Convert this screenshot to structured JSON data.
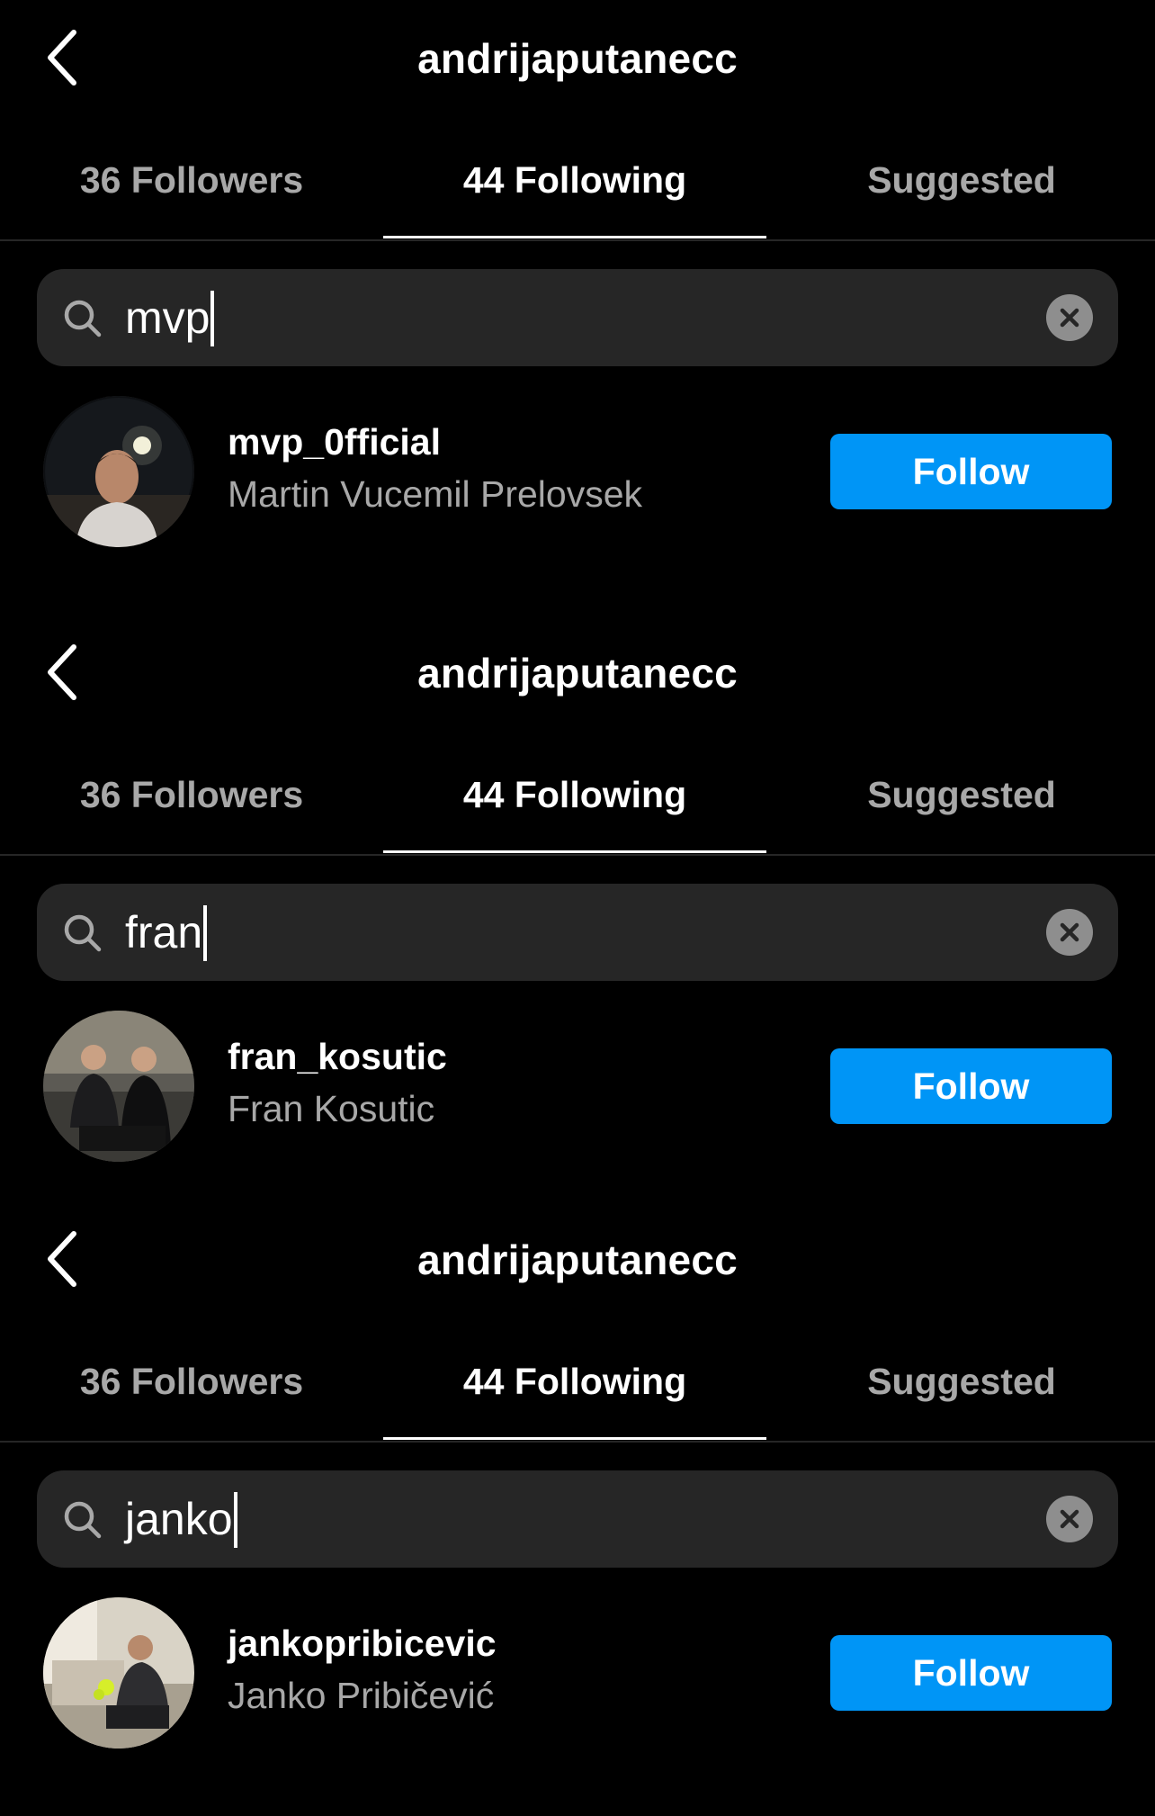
{
  "accent_color": "#0095f6",
  "panels": [
    {
      "header": {
        "back_icon": "chevron-left-icon",
        "title": "andrijaputanecc"
      },
      "tabs": [
        "36 Followers",
        "44 Following",
        "Suggested"
      ],
      "active_tab": "44 Following",
      "search": {
        "icon": "search-icon",
        "value": "mvp",
        "clear_icon": "clear-icon"
      },
      "result": {
        "username": "mvp_0fficial",
        "full_name": "Martin Vucemil Prelovsek",
        "button": "Follow"
      }
    },
    {
      "header": {
        "back_icon": "chevron-left-icon",
        "title": "andrijaputanecc"
      },
      "tabs": [
        "36 Followers",
        "44 Following",
        "Suggested"
      ],
      "active_tab": "44 Following",
      "search": {
        "icon": "search-icon",
        "value": "fran",
        "clear_icon": "clear-icon"
      },
      "result": {
        "username": "fran_kosutic",
        "full_name": "Fran Kosutic",
        "button": "Follow"
      }
    },
    {
      "header": {
        "back_icon": "chevron-left-icon",
        "title": "andrijaputanecc"
      },
      "tabs": [
        "36 Followers",
        "44 Following",
        "Suggested"
      ],
      "active_tab": "44 Following",
      "search": {
        "icon": "search-icon",
        "value": "janko",
        "clear_icon": "clear-icon"
      },
      "result": {
        "username": "jankopribicevic",
        "full_name": "Janko Pribičević",
        "button": "Follow"
      }
    }
  ]
}
